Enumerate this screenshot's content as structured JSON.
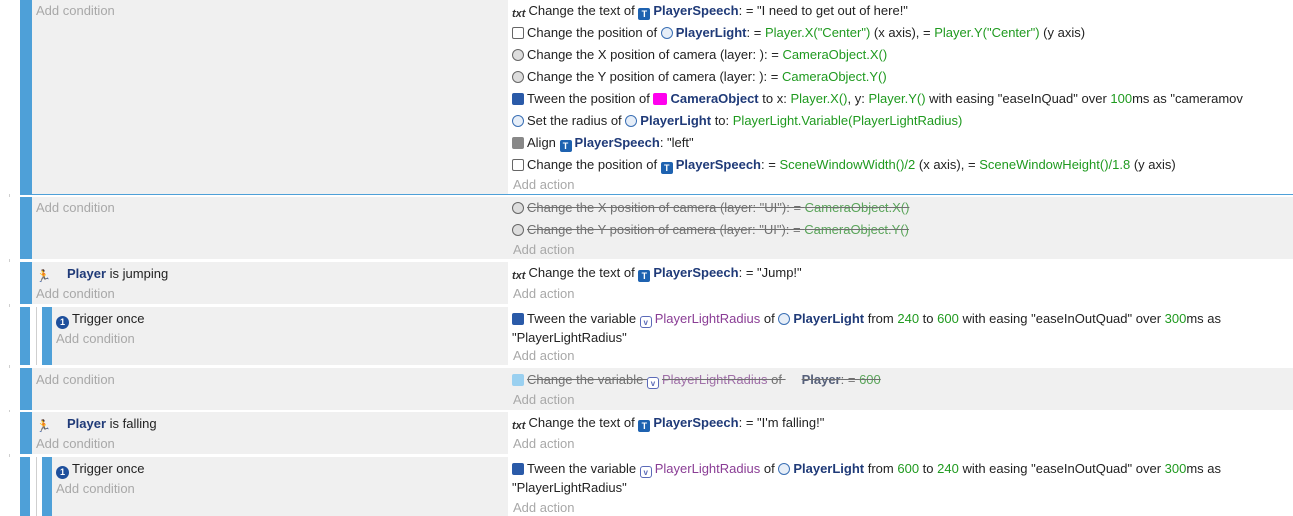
{
  "placeholders": {
    "add_condition": "Add condition",
    "add_action": "Add action"
  },
  "event1": {
    "actions": [
      {
        "pre": "Change the text of ",
        "obj": "PlayerSpeech",
        "mid": ": = ",
        "val": "\"I need to get out of here!\""
      },
      {
        "pre": "Change the position of ",
        "obj": "PlayerLight",
        "mid": ": = ",
        "v1": "Player.X(\"Center\")",
        "t1": " (x axis), = ",
        "v2": "Player.Y(\"Center\")",
        "t2": " (y axis)"
      },
      {
        "pre": "Change the X position of camera  (layer: ): = ",
        "val": "CameraObject.X()"
      },
      {
        "pre": "Change the Y position of camera  (layer: ): = ",
        "val": "CameraObject.Y()"
      },
      {
        "pre": "Tween the position of ",
        "obj": "CameraObject",
        "mid": " to x: ",
        "v1": "Player.X()",
        "t1": ", y: ",
        "v2": "Player.Y()",
        "t2": " with easing \"easeInQuad\" over ",
        "v3": "100",
        "t3": "ms as \"cameramov"
      },
      {
        "pre": "Set the radius of ",
        "obj": "PlayerLight",
        "mid": " to: ",
        "val": "PlayerLight.Variable(PlayerLightRadius)"
      },
      {
        "pre": "Align ",
        "obj": "PlayerSpeech",
        "mid": ": ",
        "val": "\"left\""
      },
      {
        "pre": "Change the position of ",
        "obj": "PlayerSpeech",
        "mid": ": = ",
        "v1": "SceneWindowWidth()/2",
        "t1": " (x axis), = ",
        "v2": "SceneWindowHeight()/1.8",
        "t2": " (y axis)"
      }
    ]
  },
  "event2": {
    "actions": [
      {
        "pre": "Change the X position of camera  (layer: \"UI\"): = ",
        "val": "CameraObject.X()"
      },
      {
        "pre": "Change the Y position of camera  (layer: \"UI\"): = ",
        "val": "CameraObject.Y()"
      }
    ]
  },
  "event3": {
    "cond_obj": "Player",
    "cond_txt": " is jumping",
    "action": {
      "pre": "Change the text of ",
      "obj": "PlayerSpeech",
      "mid": ": = ",
      "val": "\"Jump!\""
    }
  },
  "event4": {
    "cond": "Trigger once",
    "action": {
      "pre": "Tween the variable ",
      "var": "PlayerLightRadius",
      "t0": " of ",
      "obj": "PlayerLight",
      "t1": " from ",
      "v1": "240",
      "t2": " to ",
      "v2": "600",
      "t3": " with easing \"easeInOutQuad\" over ",
      "v3": "300",
      "t4": "ms as",
      "line2": "\"PlayerLightRadius\""
    }
  },
  "event5": {
    "action": {
      "pre": "Change the variable ",
      "var": "PlayerLightRadius",
      "t0": " of ",
      "obj": "Player",
      "mid": ": = ",
      "val": "600"
    }
  },
  "event6": {
    "cond_obj": "Player",
    "cond_txt": " is falling",
    "action": {
      "pre": "Change the text of ",
      "obj": "PlayerSpeech",
      "mid": ": = ",
      "val": "\"I'm falling!\""
    }
  },
  "event7": {
    "cond": "Trigger once",
    "action": {
      "pre": "Tween the variable ",
      "var": "PlayerLightRadius",
      "t0": " of ",
      "obj": "PlayerLight",
      "t1": " from ",
      "v1": "600",
      "t2": " to ",
      "v2": "240",
      "t3": " with easing \"easeInOutQuad\" over ",
      "v3": "300",
      "t4": "ms as",
      "line2": "\"PlayerLightRadius\""
    }
  }
}
